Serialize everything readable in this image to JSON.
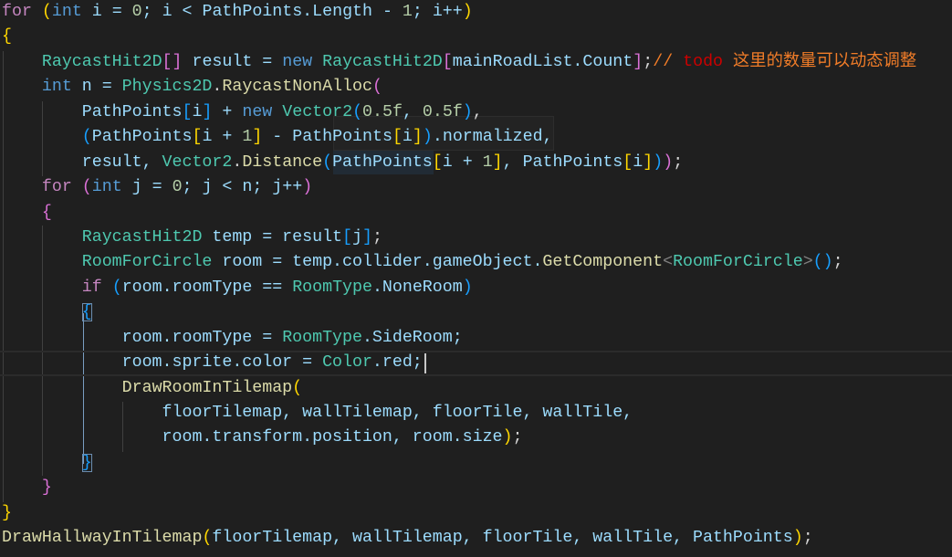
{
  "editor": {
    "language": "csharp",
    "theme_colors": {
      "background": "#1f1f1f",
      "keyword_control": "#c586c0",
      "keyword": "#569cd6",
      "type": "#4ec9b0",
      "variable": "#9cdcfe",
      "function": "#dcdcaa",
      "number": "#b5cea8",
      "comment": "#f07c28",
      "todo": "#cc0000"
    },
    "current_line": 15,
    "lines": [
      [
        [
          "for",
          "kw"
        ],
        [
          " ",
          "op"
        ],
        [
          "(",
          "b1"
        ],
        [
          "int",
          "kt"
        ],
        [
          " i = ",
          "va"
        ],
        [
          "0",
          "nu"
        ],
        [
          "; i < PathPoints.Length - ",
          "va"
        ],
        [
          "1",
          "nu"
        ],
        [
          "; i++",
          "va"
        ],
        [
          ")",
          "b1"
        ]
      ],
      [
        [
          "{",
          "b1"
        ]
      ],
      [
        [
          "    ",
          "op"
        ],
        [
          "RaycastHit2D",
          "ty"
        ],
        [
          "[]",
          "b2"
        ],
        [
          " result = ",
          "va"
        ],
        [
          "new",
          "kt"
        ],
        [
          " ",
          "op"
        ],
        [
          "RaycastHit2D",
          "ty"
        ],
        [
          "[",
          "b2"
        ],
        [
          "mainRoadList.Count",
          "va"
        ],
        [
          "]",
          "b2"
        ],
        [
          ";",
          "op"
        ],
        [
          "// ",
          "cm"
        ],
        [
          "todo",
          "todo"
        ],
        [
          " 这里的数量可以动态调整",
          "cm"
        ]
      ],
      [
        [
          "    ",
          "op"
        ],
        [
          "int",
          "kt"
        ],
        [
          " n = ",
          "va"
        ],
        [
          "Physics2D",
          "ty"
        ],
        [
          ".",
          "op"
        ],
        [
          "RaycastNonAlloc",
          "fn"
        ],
        [
          "(",
          "b2"
        ]
      ],
      [
        [
          "        PathPoints",
          "va"
        ],
        [
          "[",
          "b3"
        ],
        [
          "i",
          "va"
        ],
        [
          "]",
          "b3"
        ],
        [
          " + ",
          "va"
        ],
        [
          "new",
          "kt"
        ],
        [
          " ",
          "op"
        ],
        [
          "Vector2",
          "ty"
        ],
        [
          "(",
          "b3"
        ],
        [
          "0.5f",
          "nu"
        ],
        [
          ", ",
          "va"
        ],
        [
          "0.5f",
          "nu"
        ],
        [
          ")",
          "b3"
        ],
        [
          ",",
          "op"
        ]
      ],
      [
        [
          "        ",
          "op"
        ],
        [
          "(",
          "b3"
        ],
        [
          "PathPoints",
          "va"
        ],
        [
          "[",
          "b1"
        ],
        [
          "i + ",
          "va"
        ],
        [
          "1",
          "nu"
        ],
        [
          "]",
          "b1"
        ],
        [
          " - PathPoints",
          "va"
        ],
        [
          "[",
          "b1"
        ],
        [
          "i",
          "va"
        ],
        [
          "]",
          "b1"
        ],
        [
          ")",
          "b3"
        ],
        [
          ".normalized,",
          "va"
        ]
      ],
      [
        [
          "        result, ",
          "va"
        ],
        [
          "Vector2",
          "ty"
        ],
        [
          ".",
          "op"
        ],
        [
          "Distance",
          "fn"
        ],
        [
          "(",
          "b3"
        ],
        [
          "PathPoints",
          "va"
        ],
        [
          "[",
          "b1"
        ],
        [
          "i + ",
          "va"
        ],
        [
          "1",
          "nu"
        ],
        [
          "]",
          "b1"
        ],
        [
          ", PathPoints",
          "va"
        ],
        [
          "[",
          "b1"
        ],
        [
          "i",
          "va"
        ],
        [
          "]",
          "b1"
        ],
        [
          ")",
          "b3"
        ],
        [
          ")",
          "b2"
        ],
        [
          ";",
          "op"
        ]
      ],
      [
        [
          "    ",
          "op"
        ],
        [
          "for",
          "kw"
        ],
        [
          " ",
          "op"
        ],
        [
          "(",
          "b2"
        ],
        [
          "int",
          "kt"
        ],
        [
          " j = ",
          "va"
        ],
        [
          "0",
          "nu"
        ],
        [
          "; j < n; j++",
          "va"
        ],
        [
          ")",
          "b2"
        ]
      ],
      [
        [
          "    ",
          "op"
        ],
        [
          "{",
          "b2"
        ]
      ],
      [
        [
          "        ",
          "op"
        ],
        [
          "RaycastHit2D",
          "ty"
        ],
        [
          " temp = result",
          "va"
        ],
        [
          "[",
          "b3"
        ],
        [
          "j",
          "va"
        ],
        [
          "]",
          "b3"
        ],
        [
          ";",
          "op"
        ]
      ],
      [
        [
          "        ",
          "op"
        ],
        [
          "RoomForCircle",
          "ty"
        ],
        [
          " room = temp.collider.gameObject.",
          "va"
        ],
        [
          "GetComponent",
          "fn"
        ],
        [
          "<",
          "gt"
        ],
        [
          "RoomForCircle",
          "ty"
        ],
        [
          ">",
          "gt"
        ],
        [
          "()",
          "b3"
        ],
        [
          ";",
          "op"
        ]
      ],
      [
        [
          "        ",
          "op"
        ],
        [
          "if",
          "kw"
        ],
        [
          " ",
          "op"
        ],
        [
          "(",
          "b3"
        ],
        [
          "room.roomType == ",
          "va"
        ],
        [
          "RoomType",
          "ty"
        ],
        [
          ".NoneRoom",
          "va"
        ],
        [
          ")",
          "b3"
        ]
      ],
      [
        [
          "        ",
          "op"
        ],
        [
          "{",
          "b3 boxed"
        ]
      ],
      [
        [
          "            room.roomType = ",
          "va"
        ],
        [
          "RoomType",
          "ty"
        ],
        [
          ".SideRoom;",
          "va"
        ]
      ],
      [
        [
          "            room.sprite.color = ",
          "va"
        ],
        [
          "Color",
          "ty"
        ],
        [
          ".red;",
          "va"
        ]
      ],
      [
        [
          "            ",
          "op"
        ],
        [
          "DrawRoomInTilemap",
          "fn"
        ],
        [
          "(",
          "b1"
        ]
      ],
      [
        [
          "                floorTilemap, wallTilemap, floorTile, wallTile,",
          "va"
        ]
      ],
      [
        [
          "                room.transform.position, room.size",
          "va"
        ],
        [
          ")",
          "b1"
        ],
        [
          ";",
          "op"
        ]
      ],
      [
        [
          "        ",
          "op"
        ],
        [
          "}",
          "b3 boxed"
        ]
      ],
      [
        [
          "    ",
          "op"
        ],
        [
          "}",
          "b2"
        ]
      ],
      [
        [
          "}",
          "b1"
        ]
      ],
      [
        [
          "DrawHallwayInTilemap",
          "fn"
        ],
        [
          "(",
          "b1"
        ],
        [
          "floorTilemap, wallTilemap, floorTile, wallTile, PathPoints",
          "va"
        ],
        [
          ")",
          "b1"
        ],
        [
          ";",
          "op"
        ]
      ]
    ]
  }
}
